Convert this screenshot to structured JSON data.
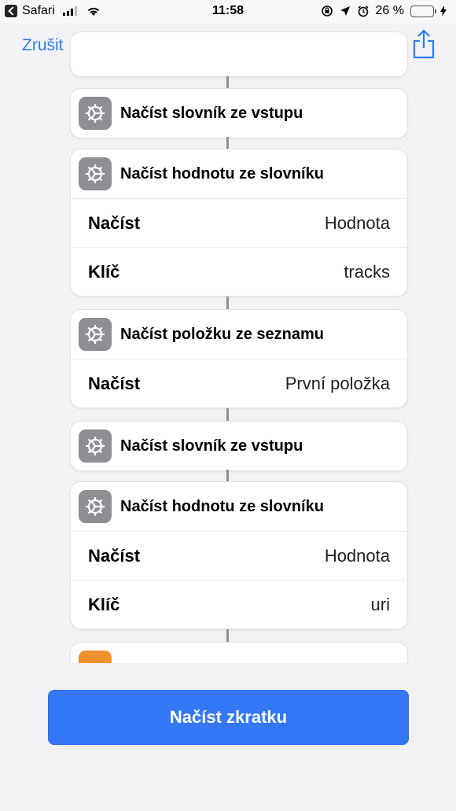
{
  "status_bar": {
    "app": "Safari",
    "time": "11:58",
    "battery": "26 %"
  },
  "nav": {
    "cancel": "Zrušit"
  },
  "cards": [
    {
      "title": "Načíst slovník ze vstupu"
    },
    {
      "title": "Načíst hodnotu ze slovníku",
      "rows": [
        {
          "key": "Načíst",
          "value": "Hodnota"
        },
        {
          "key": "Klíč",
          "value": "tracks"
        }
      ]
    },
    {
      "title": "Načíst položku ze seznamu",
      "rows": [
        {
          "key": "Načíst",
          "value": "První položka"
        }
      ]
    },
    {
      "title": "Načíst slovník ze vstupu"
    },
    {
      "title": "Načíst hodnotu ze slovníku",
      "rows": [
        {
          "key": "Načíst",
          "value": "Hodnota"
        },
        {
          "key": "Klíč",
          "value": "uri"
        }
      ]
    }
  ],
  "primary_button": "Načíst zkratku",
  "colors": {
    "accent": "#2f7cf6",
    "button": "#3478f6",
    "action_icon": "#8e8e93",
    "partial_icon": "#f0902e"
  },
  "icons": {
    "action": "gear-icon",
    "share": "share-icon"
  }
}
